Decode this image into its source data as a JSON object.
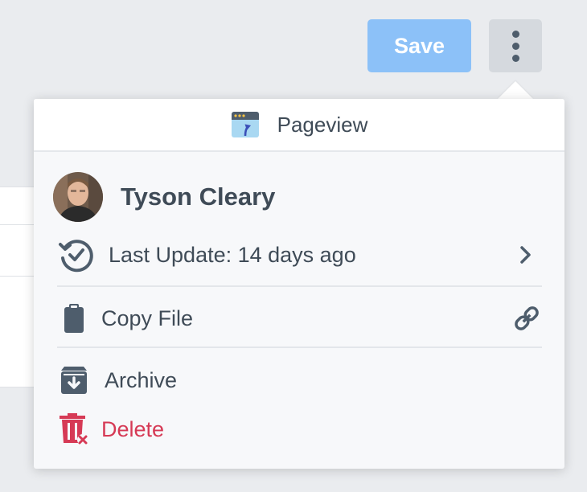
{
  "toolbar": {
    "save_label": "Save",
    "more_icon": "more-vertical-icon"
  },
  "menu": {
    "header": {
      "title": "Pageview",
      "icon": "pageview-icon"
    },
    "user": {
      "name": "Tyson Cleary"
    },
    "last_update": {
      "label": "Last Update: 14 days ago",
      "icon": "history-check-icon",
      "trail_icon": "chevron-right-icon"
    },
    "copy_file": {
      "label": "Copy File",
      "icon": "clipboard-icon",
      "trail_icon": "link-icon"
    },
    "archive": {
      "label": "Archive",
      "icon": "archive-icon"
    },
    "delete": {
      "label": "Delete",
      "icon": "trash-x-icon"
    }
  },
  "colors": {
    "primary_disabled": "#8cc1f8",
    "text": "#3f4b57",
    "danger": "#d63a55",
    "menu_bg": "#f7f8fa"
  }
}
